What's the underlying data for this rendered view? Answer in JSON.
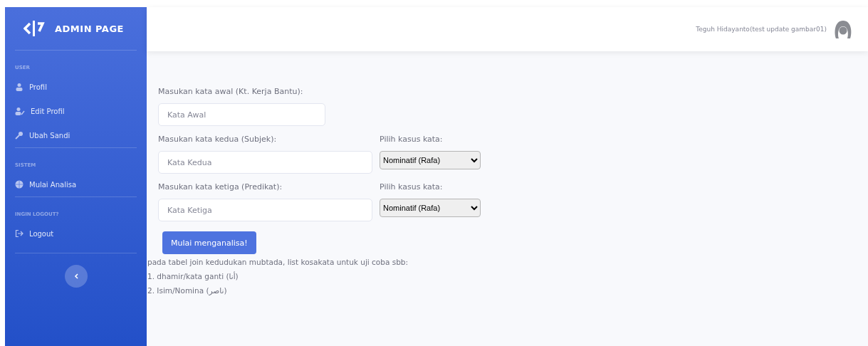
{
  "sidebar": {
    "brand": "ADMIN PAGE",
    "sections": [
      {
        "heading": "USER",
        "items": [
          {
            "label": "Profil",
            "kind": "user"
          },
          {
            "label": "Edit Profil",
            "kind": "useredit"
          },
          {
            "label": "Ubah Sandi",
            "kind": "key"
          }
        ]
      },
      {
        "heading": "SISTEM",
        "items": [
          {
            "label": "Mulai Analisa",
            "kind": "globe"
          }
        ]
      },
      {
        "heading": "INGIN LOGOUT?",
        "items": [
          {
            "label": "Logout",
            "kind": "logout"
          }
        ]
      }
    ]
  },
  "topbar": {
    "user_name": "Teguh Hidayanto(test update gambar01)"
  },
  "form": {
    "rows": [
      {
        "label": "Masukan kata awal (Kt. Kerja Bantu):",
        "placeholder": "Kata Awal"
      },
      {
        "label": "Masukan kata kedua (Subjek):",
        "placeholder": "Kata Kedua",
        "select_label": "Pilih kasus kata:",
        "select_value": "Nominatif (Rafa)"
      },
      {
        "label": "Masukan kata ketiga (Predikat):",
        "placeholder": "Kata Ketiga",
        "select_label": "Pilih kasus kata:",
        "select_value": "Nominatif (Rafa)"
      }
    ],
    "submit": "Mulai menganalisa!"
  },
  "notes": [
    "pada tabel join kedudukan mubtada, list kosakata untuk uji coba sbb:",
    "1. dhamir/kata ganti (أنا)",
    "2. Isim/Nomina (ناصر)"
  ]
}
